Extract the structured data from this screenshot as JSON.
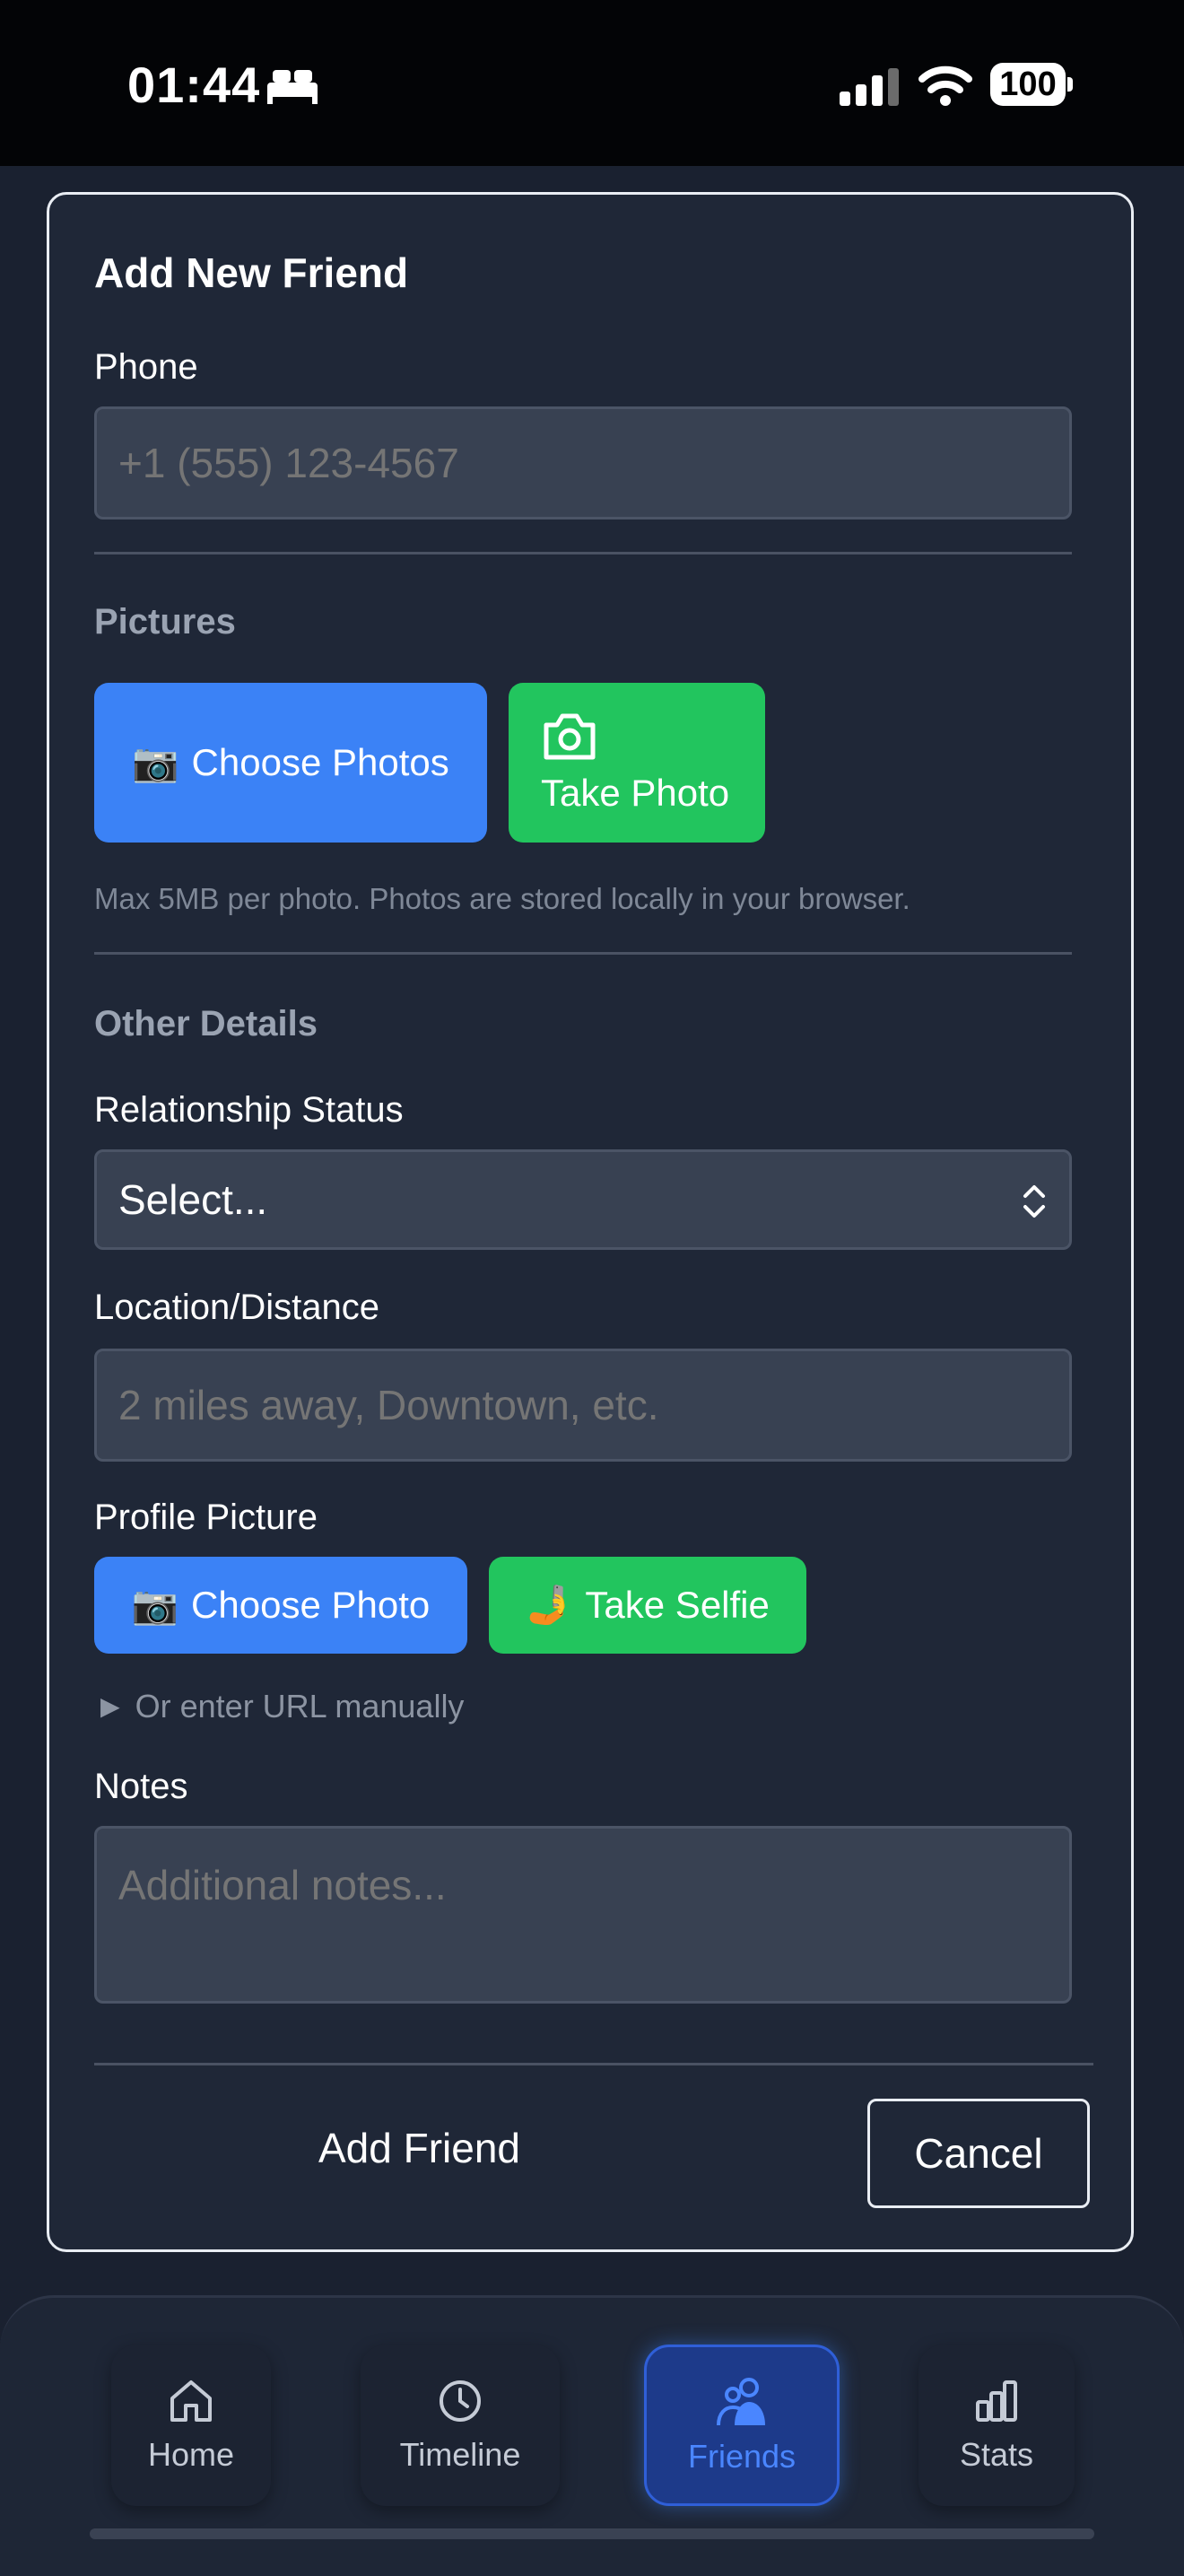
{
  "status_bar": {
    "time": "01:44",
    "battery": "100"
  },
  "form": {
    "title": "Add New Friend",
    "phone": {
      "label": "Phone",
      "placeholder": "+1 (555) 123-4567"
    },
    "pictures": {
      "section_label": "Pictures",
      "choose_photos_label": "Choose Photos",
      "choose_photos_icon": "📷",
      "take_photo_label": "Take Photo",
      "take_photo_icon": "camera-icon",
      "hint": "Max 5MB per photo. Photos are stored locally in your browser."
    },
    "other_details": {
      "section_label": "Other Details",
      "relationship_label": "Relationship Status",
      "relationship_value": "Select...",
      "location_label": "Location/Distance",
      "location_placeholder": "2 miles away, Downtown, etc.",
      "profile_picture_label": "Profile Picture",
      "choose_photo_label": "Choose Photo",
      "choose_photo_icon": "📷",
      "take_selfie_label": "Take Selfie",
      "take_selfie_icon": "🤳",
      "url_toggle": "► Or enter URL manually",
      "notes_label": "Notes",
      "notes_placeholder": "Additional notes..."
    },
    "actions": {
      "submit_label": "Add Friend",
      "cancel_label": "Cancel"
    }
  },
  "bottom_nav": {
    "items": [
      {
        "label": "Home",
        "icon": "home-icon"
      },
      {
        "label": "Timeline",
        "icon": "clock-icon"
      },
      {
        "label": "Friends",
        "icon": "friends-icon",
        "active": true
      },
      {
        "label": "Stats",
        "icon": "bar-chart-icon"
      }
    ]
  },
  "colors": {
    "accent_blue": "#3b82f6",
    "accent_green": "#22c55e",
    "background": "#1a2130",
    "card": "#1f2737"
  }
}
